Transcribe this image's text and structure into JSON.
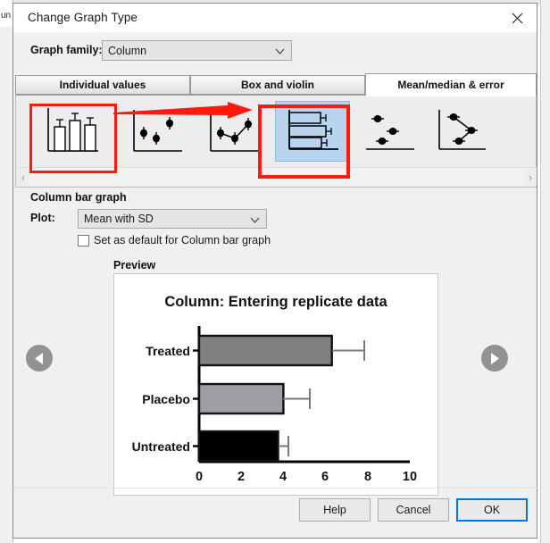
{
  "window": {
    "title": "Change Graph Type",
    "close_icon": "close-icon"
  },
  "background_app": {
    "left_edge_text": "un"
  },
  "graph_family": {
    "label": "Graph family:",
    "value": "Column",
    "chevron_icon": "chevron-down-icon"
  },
  "tabs": [
    {
      "label": "Individual values",
      "active": false
    },
    {
      "label": "Box and violin",
      "active": false
    },
    {
      "label": "Mean/median & error",
      "active": true
    }
  ],
  "gallery": {
    "thumbnails": [
      {
        "name": "column-bar-graph",
        "icon": "vertical-bars-with-error-icon",
        "selected": false,
        "annotated": true
      },
      {
        "name": "scatter-mean-error",
        "icon": "scatter-points-with-error-icon",
        "selected": false,
        "annotated": false
      },
      {
        "name": "scatter-connecting-line",
        "icon": "connected-points-with-error-icon",
        "selected": false,
        "annotated": false
      },
      {
        "name": "horizontal-bar-graph",
        "icon": "horizontal-bars-with-error-icon",
        "selected": true,
        "annotated": true
      },
      {
        "name": "horizontal-scatter-mean-error",
        "icon": "horizontal-points-with-error-icon",
        "selected": false,
        "annotated": false
      },
      {
        "name": "horizontal-connected-points",
        "icon": "horizontal-connected-points-icon",
        "selected": false,
        "annotated": false
      }
    ],
    "scroll_left_icon": "chevron-left-icon",
    "scroll_right_icon": "chevron-right-icon"
  },
  "plot_section": {
    "section_title": "Column bar graph",
    "plot_label": "Plot:",
    "plot_value": "Mean with SD",
    "chevron_icon": "chevron-down-icon",
    "default_checkbox_label": "Set as default for Column bar graph",
    "default_checkbox_checked": false,
    "preview_label": "Preview"
  },
  "navigation": {
    "prev_icon": "arrow-left-circle-icon",
    "next_icon": "arrow-right-circle-icon"
  },
  "footer": {
    "help_label": "Help",
    "cancel_label": "Cancel",
    "ok_label": "OK"
  },
  "colors": {
    "accent": "#0078d7",
    "annotation_red": "#fc1b0c",
    "selection_blue": "#b9d4ee",
    "bar_treated": "#808080",
    "bar_placebo": "#9e9ea4",
    "bar_untreated": "#000000"
  },
  "chart_data": {
    "type": "bar",
    "orientation": "horizontal",
    "title": "Column: Entering replicate data",
    "xlabel": "",
    "ylabel": "",
    "categories": [
      "Treated",
      "Placebo",
      "Untreated"
    ],
    "values": [
      6.3,
      4.0,
      3.75
    ],
    "errors": [
      1.5,
      1.25,
      0.45
    ],
    "error_type": "SD",
    "bar_colors": [
      "#808080",
      "#9e9ea4",
      "#000000"
    ],
    "xlim": [
      0,
      10
    ],
    "xticks": [
      0,
      2,
      4,
      6,
      8,
      10
    ],
    "xtick_labels": [
      "0",
      "2",
      "4",
      "6",
      "8",
      "10"
    ],
    "grid": false,
    "legend": false
  }
}
